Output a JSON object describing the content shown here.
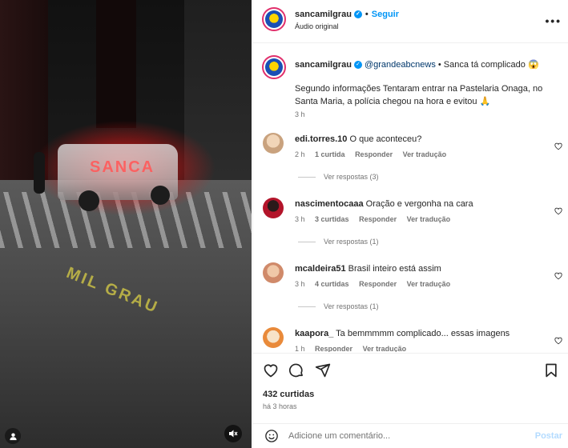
{
  "media": {
    "car_text": "SANCA",
    "street_text": "MIL GRAU"
  },
  "header": {
    "username": "sancamilgrau",
    "separator": "•",
    "follow_label": "Seguir",
    "audio_label": "Áudio original",
    "more_icon": "more-horizontal-icon"
  },
  "caption": {
    "username": "sancamilgrau",
    "mention": "@grandeabcnews",
    "title": "• Sanca tá complicado 😱",
    "body": "Segundo informações Tentaram entrar na Pastelaria Onaga, no Santa Maria, a polícia chegou na hora e evitou 🙏",
    "time": "3 h"
  },
  "comments": [
    {
      "username": "edi.torres.10",
      "text": "O que aconteceu?",
      "time": "2 h",
      "likes": "1 curtida",
      "reply": "Responder",
      "translate": "Ver tradução",
      "replies": "Ver respostas (3)",
      "avatar_color": "#c9a27e"
    },
    {
      "username": "nascimentocaaa",
      "text": "Oração e vergonha na cara",
      "time": "3 h",
      "likes": "3 curtidas",
      "reply": "Responder",
      "translate": "Ver tradução",
      "replies": "Ver respostas (1)",
      "avatar_color": "#b3142a"
    },
    {
      "username": "mcaldeira51",
      "text": "Brasil inteiro está assim",
      "time": "3 h",
      "likes": "4 curtidas",
      "reply": "Responder",
      "translate": "Ver tradução",
      "replies": "Ver respostas (1)",
      "avatar_color": "#d08a6a"
    },
    {
      "username": "kaapora_",
      "text": "Ta bemmmmm complicado... essas imagens",
      "time": "1 h",
      "likes": "",
      "reply": "Responder",
      "translate": "Ver tradução",
      "replies": "",
      "avatar_color": "#e98a3a"
    }
  ],
  "actions": {
    "likes": "432 curtidas",
    "ago": "há 3 horas"
  },
  "add_comment": {
    "placeholder": "Adicione um comentário...",
    "post_label": "Postar"
  },
  "colors": {
    "accent": "#0095f6",
    "ring": "#e1306c"
  }
}
